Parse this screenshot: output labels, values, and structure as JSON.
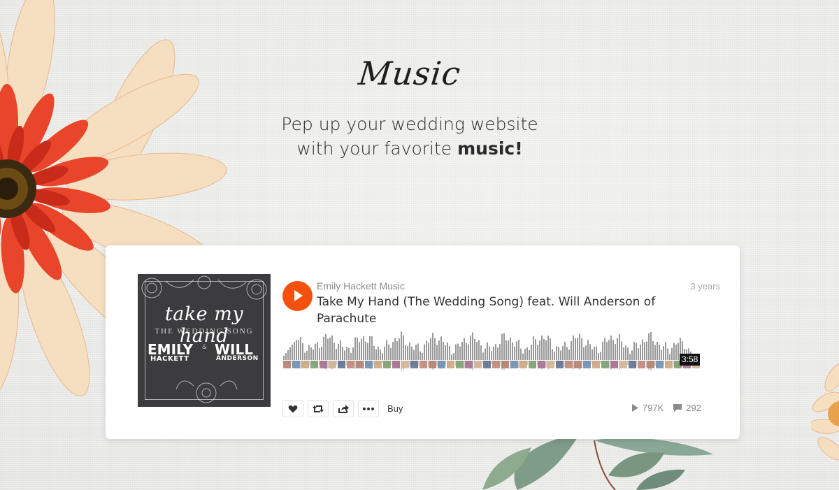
{
  "heading": {
    "title": "Music",
    "tagline_line1": "Pep up your wedding website",
    "tagline_line2_pre": "with your favorite ",
    "tagline_line2_bold": "music",
    "tagline_line2_post": "!"
  },
  "player": {
    "artist": "Emily Hackett Music",
    "track_title": "Take My Hand (The Wedding Song) feat. Will Anderson of Parachute",
    "uploaded_ago": "3 years",
    "duration": "3:58",
    "played_fraction": 0,
    "actions": {
      "like_icon": "heart-icon",
      "repost_icon": "repost-icon",
      "share_icon": "share-icon",
      "more_icon": "more-icon",
      "buy_label": "Buy"
    },
    "plays": "797K",
    "comments": "292",
    "accent_color": "#f5500e",
    "artwork": {
      "script_title": "take my hand",
      "subtitle": "THE WEDDING SONG",
      "name1_first": "EMILY",
      "name1_last": "HACKETT",
      "connector": "&",
      "name2_first": "WILL",
      "name2_last": "ANDERSON"
    }
  }
}
